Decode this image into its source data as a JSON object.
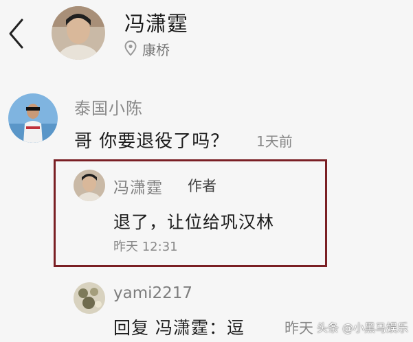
{
  "header": {
    "author_name": "冯潇霆",
    "location": "康桥",
    "icons": {
      "back": "chevron-left-icon",
      "location": "map-pin-icon"
    }
  },
  "comments": [
    {
      "username": "泰国小陈",
      "text": "哥 你要退役了吗？",
      "time": "1天前",
      "reply": {
        "username": "冯潇霆",
        "badge": "作者",
        "text": "退了，让位给巩汉林",
        "time": "昨天 12:31"
      }
    },
    {
      "username": "yami2217",
      "text": "回复 冯潇霆：逗",
      "time": "昨天"
    }
  ],
  "watermark": "头条 @小黑马娱乐",
  "colors": {
    "highlight_border": "#7a1f24",
    "background": "#f6f6f6"
  }
}
